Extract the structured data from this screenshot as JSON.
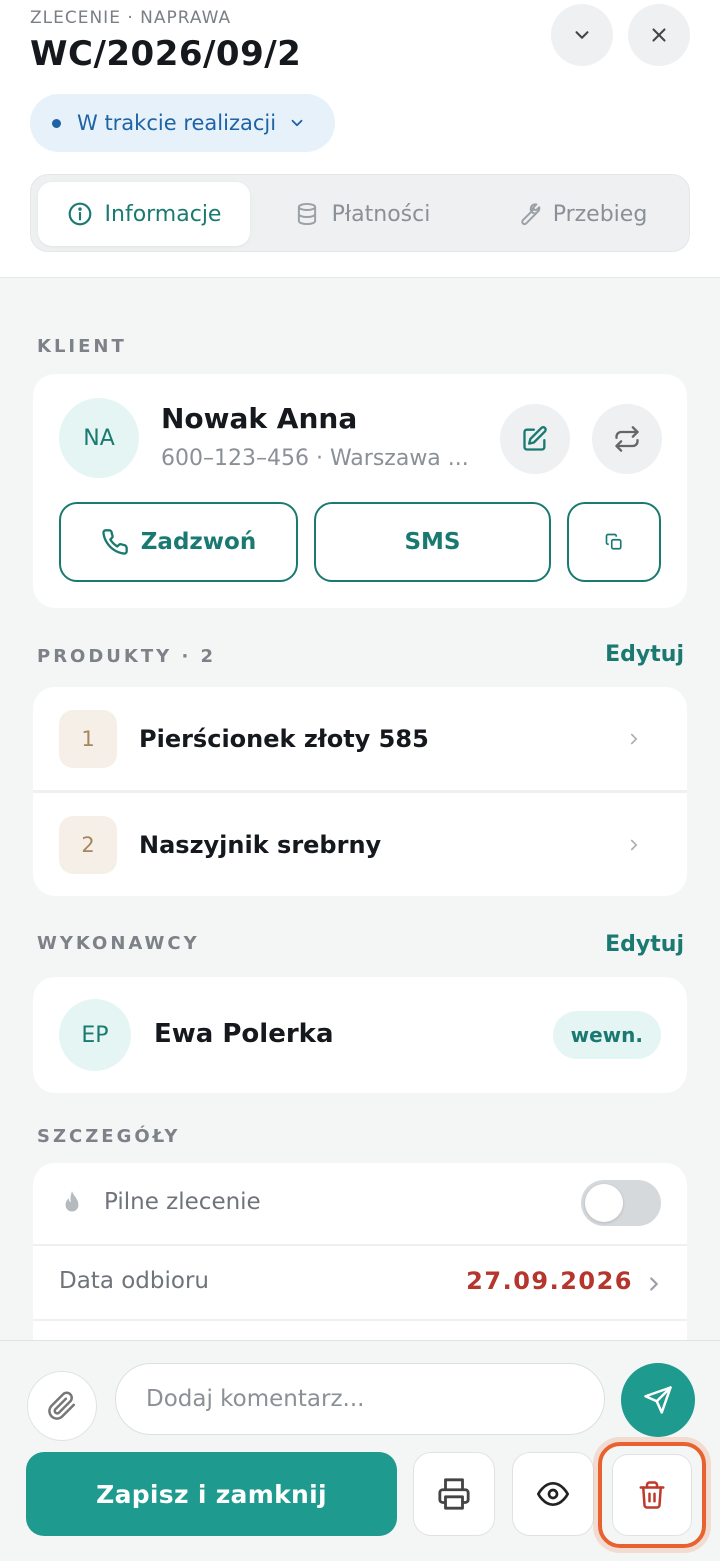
{
  "header": {
    "eyebrow": "ZLECENIE · NAPRAWA",
    "order_number": "WC/2026/09/2",
    "status_label": "W trakcie realizacji",
    "status_color": "#1e63a6"
  },
  "tabs": [
    {
      "label": "Informacje",
      "icon": "info-icon",
      "active": true
    },
    {
      "label": "Płatności",
      "icon": "database-icon",
      "active": false
    },
    {
      "label": "Przebieg",
      "icon": "wrench-icon",
      "active": false
    }
  ],
  "client": {
    "section_label": "KLIENT",
    "initials": "NA",
    "name": "Nowak Anna",
    "subtitle": "600–123–456 · Warszawa ...",
    "call_label": "Zadzwoń",
    "sms_label": "SMS"
  },
  "products": {
    "section_label": "PRODUKTY · 2",
    "edit_label": "Edytuj",
    "items": [
      {
        "index": "1",
        "name": "Pierścionek złoty 585"
      },
      {
        "index": "2",
        "name": "Naszyjnik srebrny"
      }
    ]
  },
  "contractors": {
    "section_label": "WYKONAWCY",
    "edit_label": "Edytuj",
    "items": [
      {
        "initials": "EP",
        "name": "Ewa Polerka",
        "badge": "wewn."
      }
    ]
  },
  "details": {
    "section_label": "SZCZEGÓŁY",
    "urgent_label": "Pilne zlecenie",
    "urgent_on": false,
    "pickup_label": "Data odbioru",
    "pickup_value": "27.09.2026"
  },
  "footer": {
    "comment_placeholder": "Dodaj komentarz...",
    "save_label": "Zapisz i zamknij"
  },
  "colors": {
    "accent": "#1a7a72",
    "primary_button": "#1f9a8f",
    "date_red": "#b4362c",
    "highlight": "#e8622f"
  }
}
